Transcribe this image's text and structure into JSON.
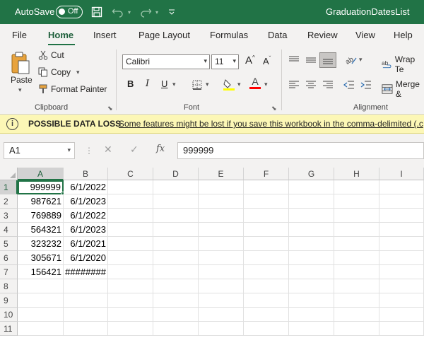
{
  "titlebar": {
    "autosave_label": "AutoSave",
    "autosave_state": "Off",
    "document_title": "GraduationDatesList"
  },
  "tabs": [
    "File",
    "Home",
    "Insert",
    "Page Layout",
    "Formulas",
    "Data",
    "Review",
    "View",
    "Help"
  ],
  "active_tab": "Home",
  "ribbon": {
    "clipboard": {
      "paste": "Paste",
      "cut": "Cut",
      "copy": "Copy",
      "format_painter": "Format Painter",
      "label": "Clipboard"
    },
    "font": {
      "font_name": "Calibri",
      "font_size": "11",
      "bold": "B",
      "italic": "I",
      "underline": "U",
      "grow": "A",
      "shrink": "A",
      "label": "Font",
      "highlight_color": "#ffff00",
      "font_color": "#ff0000"
    },
    "alignment": {
      "wrap_text": "Wrap Te",
      "merge": "Merge &",
      "label": "Alignment"
    }
  },
  "message_bar": {
    "title": "POSSIBLE DATA LOSS",
    "message": "Some features might be lost if you save this workbook in the comma-delimited (.c"
  },
  "formula_bar": {
    "name_box": "A1",
    "fx": "fx",
    "value": "999999"
  },
  "grid": {
    "columns": [
      "A",
      "B",
      "C",
      "D",
      "E",
      "F",
      "G",
      "H",
      "I"
    ],
    "rows": [
      "1",
      "2",
      "3",
      "4",
      "5",
      "6",
      "7",
      "8",
      "9",
      "10",
      "11"
    ],
    "data": [
      [
        "999999",
        "6/1/2022"
      ],
      [
        "987621",
        "6/1/2023"
      ],
      [
        "769889",
        "6/1/2022"
      ],
      [
        "564321",
        "6/1/2023"
      ],
      [
        "323232",
        "6/1/2021"
      ],
      [
        "305671",
        "6/1/2020"
      ],
      [
        "156421",
        "########"
      ]
    ]
  },
  "colors": {
    "brand": "#217346",
    "message_bar": "#fcf7b6"
  }
}
